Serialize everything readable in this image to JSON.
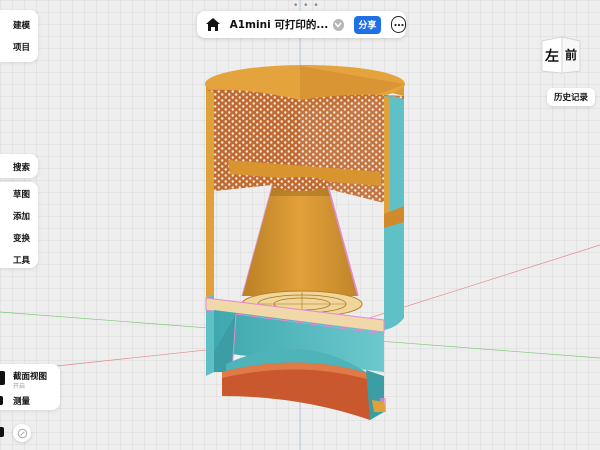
{
  "toolbar": {
    "doc_title": "A1mini 可打印的...",
    "share_label": "分享"
  },
  "left_menu": {
    "build": "建模",
    "project": "项目",
    "search": "搜索",
    "sketch": "草图",
    "add": "添加",
    "transform": "变换",
    "tools": "工具",
    "section_view": "截面视图",
    "section_view_state": "开启",
    "measure": "测量"
  },
  "right_panel": {
    "history": "历史记录"
  },
  "view_cube": {
    "left_face": "左",
    "front_face": "前"
  },
  "icons": [
    "home-icon",
    "chevron-down-icon",
    "more-icon",
    "section-view-icon",
    "measure-icon",
    "settings-icon",
    "view-cube-icon"
  ],
  "colors": {
    "accent": "#1f6fe5",
    "model_orange": "#e2a03a",
    "model_teal": "#58bfc4",
    "model_rust": "#c9582e"
  }
}
